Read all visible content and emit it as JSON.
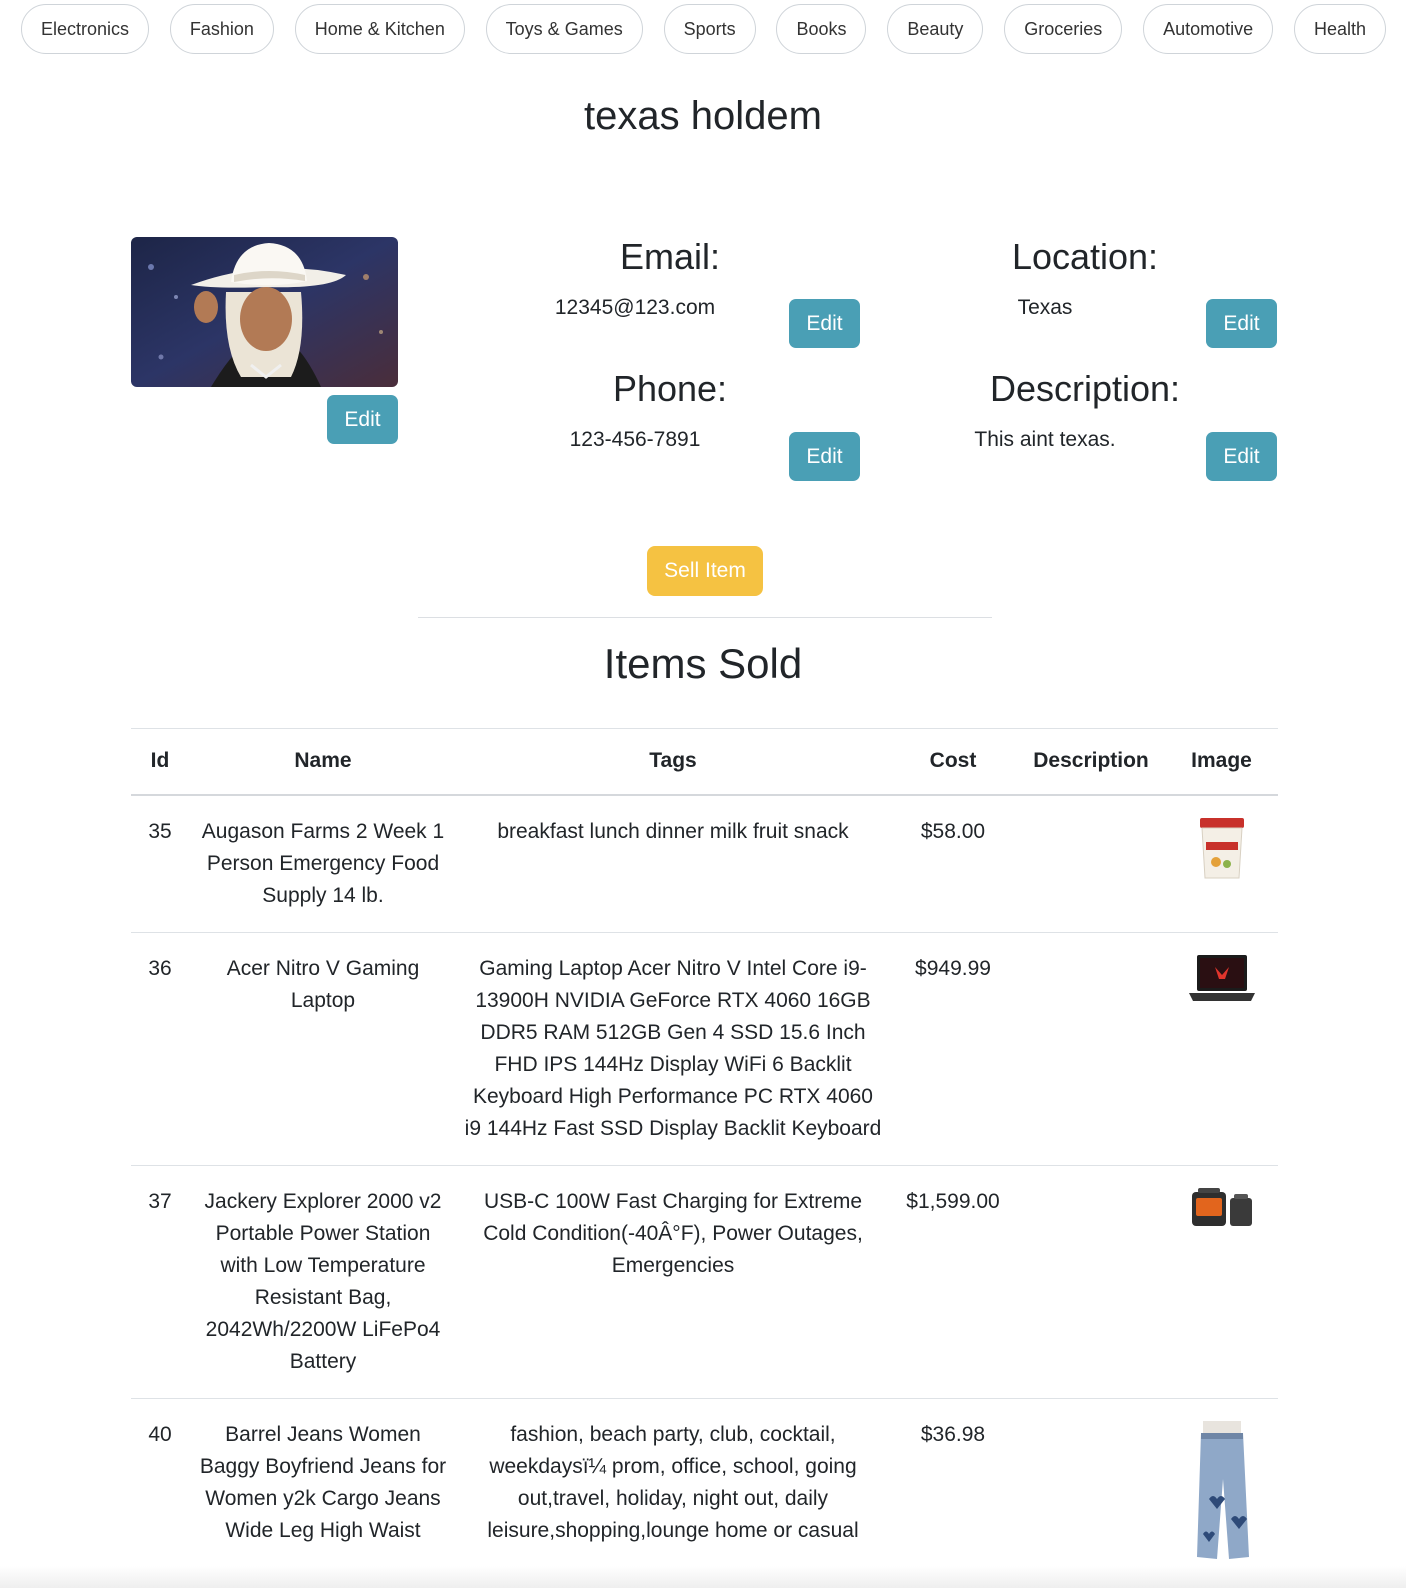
{
  "categories": [
    "Electronics",
    "Fashion",
    "Home & Kitchen",
    "Toys & Games",
    "Sports",
    "Books",
    "Beauty",
    "Groceries",
    "Automotive",
    "Health"
  ],
  "profile": {
    "title": "texas holdem",
    "avatar_icon": "profile-photo",
    "email_label": "Email:",
    "email": "12345@123.com",
    "phone_label": "Phone:",
    "phone": "123-456-7891",
    "location_label": "Location:",
    "location": "Texas",
    "description_label": "Description:",
    "description": "This aint texas.",
    "edit_label": "Edit",
    "sell_label": "Sell Item"
  },
  "items_section": {
    "title": "Items Sold",
    "columns": [
      "Id",
      "Name",
      "Tags",
      "Cost",
      "Description",
      "Image"
    ],
    "rows": [
      {
        "id": "35",
        "name": "Augason Farms 2 Week 1 Person Emergency Food Supply 14 lb.",
        "tags": "breakfast lunch dinner milk fruit snack",
        "cost": "$58.00",
        "description": "",
        "image_icon": "food-bucket"
      },
      {
        "id": "36",
        "name": "Acer Nitro V Gaming Laptop",
        "tags": "Gaming Laptop Acer Nitro V Intel Core i9-13900H NVIDIA GeForce RTX 4060 16GB DDR5 RAM 512GB Gen 4 SSD 15.6 Inch FHD IPS 144Hz Display WiFi 6 Backlit Keyboard High Performance PC RTX 4060 i9 144Hz Fast SSD Display Backlit Keyboard",
        "cost": "$949.99",
        "description": "",
        "image_icon": "laptop"
      },
      {
        "id": "37",
        "name": "Jackery Explorer 2000 v2 Portable Power Station with Low Temperature Resistant Bag, 2042Wh/2200W LiFePo4 Battery",
        "tags": "USB-C 100W Fast Charging for Extreme Cold Condition(-40Â°F), Power Outages, Emergencies",
        "cost": "$1,599.00",
        "description": "",
        "image_icon": "power-station"
      },
      {
        "id": "40",
        "name": "Barrel Jeans Women Baggy Boyfriend Jeans for Women y2k Cargo Jeans Wide Leg High Waist",
        "tags": "fashion, beach party, club, cocktail, weekdaysï¼ prom, office, school, going out,travel, holiday, night out, daily leisure,shopping,lounge home or casual",
        "cost": "$36.98",
        "description": "",
        "image_icon": "jeans"
      }
    ]
  }
}
